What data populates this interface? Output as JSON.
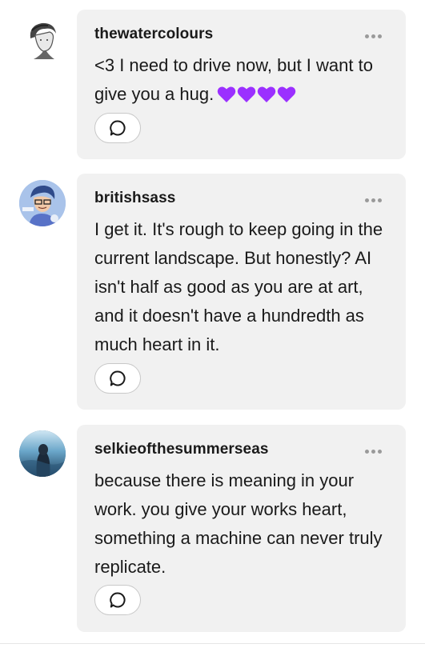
{
  "replies": [
    {
      "username": "thewatercolours",
      "text": "<3 I need to drive now, but I want to give you a hug.",
      "emoji": "purple-heart x4",
      "avatar": "sketch-portrait"
    },
    {
      "username": "britishsass",
      "text": "I get it. It's rough to keep going in the current landscape. But honestly? AI isn't half as good as you are at art, and it doesn't have a hundredth as much heart in it.",
      "avatar": "cartoon-character"
    },
    {
      "username": "selkieofthesummerseas",
      "text": "because there is meaning in your work. you give your works heart, something a machine can never truly replicate.",
      "avatar": "sea-photo"
    }
  ],
  "colors": {
    "bubble": "#f1f1f1",
    "heart": "#9b30ff",
    "menu_dots": "#9a9a9a"
  },
  "icons": {
    "menu": "more-options-icon",
    "reply": "speech-bubble-icon"
  }
}
